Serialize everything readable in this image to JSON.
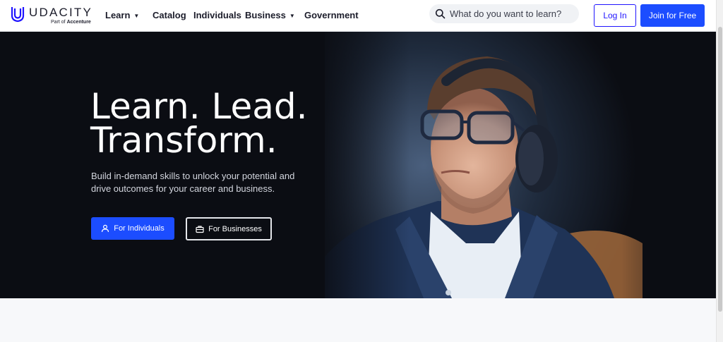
{
  "brand": {
    "name": "UDACITY",
    "sub_prefix": "Part of",
    "sub_brand": "Accenture",
    "accent": "#1c4dff"
  },
  "nav": {
    "items": [
      {
        "label": "Learn",
        "dropdown": true
      },
      {
        "label": "Catalog",
        "dropdown": false
      },
      {
        "label": "Individuals",
        "dropdown": false
      },
      {
        "label": "Business",
        "dropdown": true
      },
      {
        "label": "Government",
        "dropdown": false
      }
    ],
    "caret": "▼"
  },
  "search": {
    "placeholder": "What do you want to learn?",
    "value": "",
    "icon": "search-icon"
  },
  "auth": {
    "login_label": "Log In",
    "join_label": "Join for Free"
  },
  "hero": {
    "title_line1": "Learn. Lead.",
    "title_line2": "Transform.",
    "description": "Build in-demand skills to unlock your potential and drive outcomes for your career and business.",
    "cta_individuals": "For Individuals",
    "cta_businesses": "For Businesses",
    "individuals_icon": "user-icon",
    "businesses_icon": "briefcase-icon"
  }
}
